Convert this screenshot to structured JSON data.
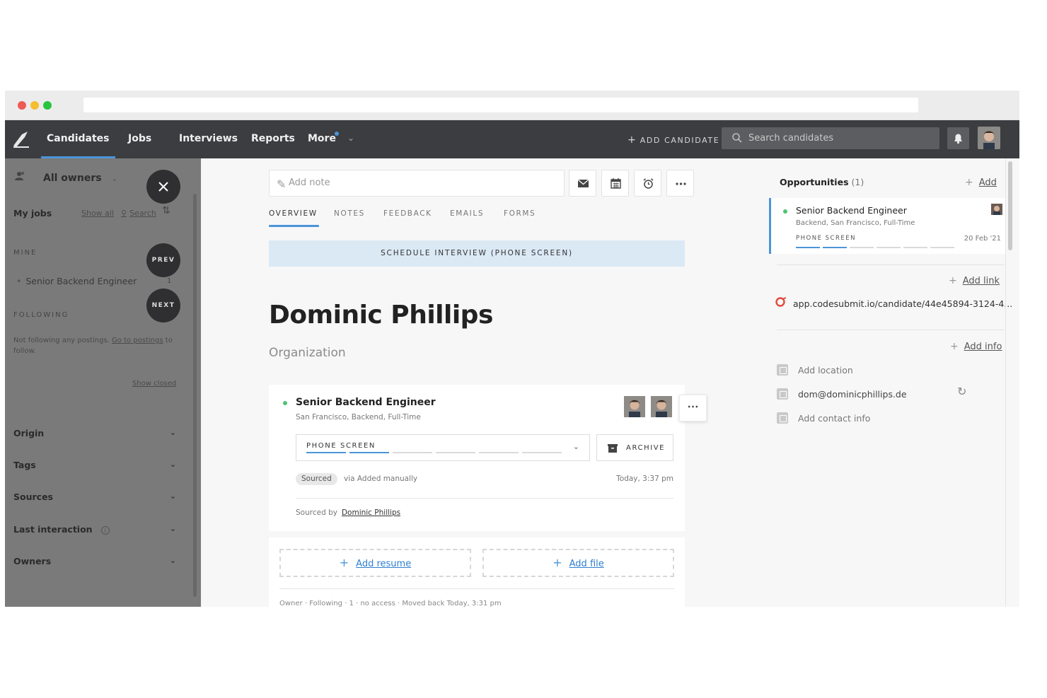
{
  "nav": {
    "items": [
      {
        "label": "Candidates",
        "active": true
      },
      {
        "label": "Jobs"
      },
      {
        "label": "Interviews"
      },
      {
        "label": "Reports"
      },
      {
        "label": "More"
      }
    ],
    "add_candidate": "ADD CANDIDATE",
    "search_placeholder": "Search candidates"
  },
  "sidebar": {
    "owners_label": "All owners",
    "my_jobs": "My jobs",
    "show_all": "Show all",
    "search": "Search",
    "mine_label": "MINE",
    "job_item": "Senior Backend Engineer",
    "job_count": "1",
    "following_label": "FOLLOWING",
    "not_following_text": "Not following any postings.",
    "go_to_postings": "Go to postings",
    "to_follow": "to follow.",
    "show_closed": "Show closed",
    "prev": "PREV",
    "next": "NEXT",
    "filters": [
      "Origin",
      "Tags",
      "Sources",
      "Last interaction",
      "Owners"
    ]
  },
  "main": {
    "note_placeholder": "Add note",
    "tabs": [
      "OVERVIEW",
      "NOTES",
      "FEEDBACK",
      "EMAILS",
      "FORMS"
    ],
    "schedule": "SCHEDULE INTERVIEW (PHONE SCREEN)",
    "candidate_name": "Dominic Phillips",
    "organization": "Organization",
    "opportunity": {
      "title": "Senior Backend Engineer",
      "subtitle": "San Francisco, Backend, Full-Time",
      "stage": "PHONE SCREEN",
      "stage_progress": 0.33,
      "archive": "ARCHIVE",
      "source_tag": "Sourced",
      "via": "via Added manually",
      "time": "Today, 3:37 pm",
      "sourced_by_label": "Sourced by",
      "sourced_by": "Dominic Phillips"
    },
    "add_resume": "Add resume",
    "add_file": "Add file",
    "footer_row": "Owner  ·  Following  ·  1 · no access  ·  Moved back Today, 3:31 pm"
  },
  "right": {
    "opportunities_label": "Opportunities",
    "opportunities_count": "(1)",
    "add": "Add",
    "card": {
      "title": "Senior Backend Engineer",
      "subtitle": "Backend, San Francisco, Full-Time",
      "stage": "PHONE SCREEN",
      "date": "20 Feb '21",
      "stage_progress": 0.33
    },
    "add_link": "Add link",
    "link": "app.codesubmit.io/candidate/44e45894-3124-4...",
    "add_info": "Add info",
    "add_location": "Add location",
    "email": "dom@dominicphillips.de",
    "add_contact": "Add contact info"
  },
  "colors": {
    "accent": "#4b95d9",
    "nav_bg": "#3c3d41",
    "status_green": "#4ec374"
  }
}
